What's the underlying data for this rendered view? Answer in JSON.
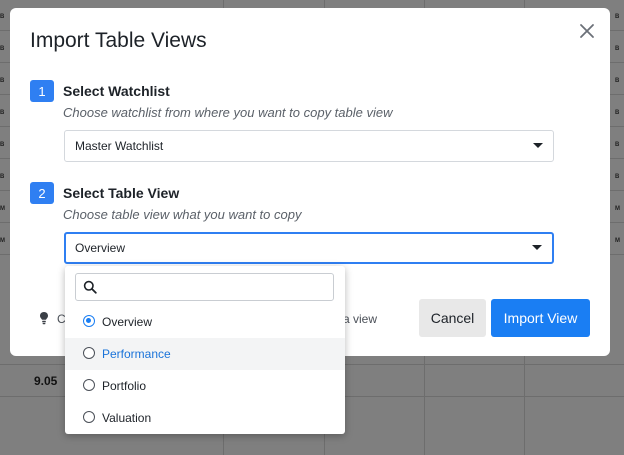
{
  "background": {
    "row_tags_left": [
      "B",
      "B",
      "B",
      "B",
      "B",
      "B",
      "M",
      "M"
    ],
    "row_tags_right": [
      "B",
      "B",
      "B",
      "B",
      "B",
      "B",
      "M",
      "M"
    ],
    "cell_value": "9.05"
  },
  "modal": {
    "title": "Import Table Views",
    "close_icon": "close-icon",
    "steps": [
      {
        "number": "1",
        "title": "Select Watchlist",
        "subtitle": "Choose watchlist from where you want to copy table view"
      },
      {
        "number": "2",
        "title": "Select Table View",
        "subtitle": "Choose table view what you want to copy"
      }
    ],
    "watchlist_select": {
      "value": "Master Watchlist"
    },
    "table_view_select": {
      "value": "Overview"
    },
    "hint": {
      "icon": "lightbulb-icon",
      "visible_start": "C",
      "visible_end": "a view"
    },
    "cancel_label": "Cancel",
    "import_label": "Import View"
  },
  "dropdown": {
    "search_icon": "search-icon",
    "search_value": "",
    "options": [
      {
        "label": "Overview",
        "checked": true
      },
      {
        "label": "Performance",
        "checked": false,
        "hovered": true
      },
      {
        "label": "Portfolio",
        "checked": false
      },
      {
        "label": "Valuation",
        "checked": false
      }
    ]
  },
  "colors": {
    "accent": "#1a7ef3",
    "overlay": "#7f7f7f"
  }
}
